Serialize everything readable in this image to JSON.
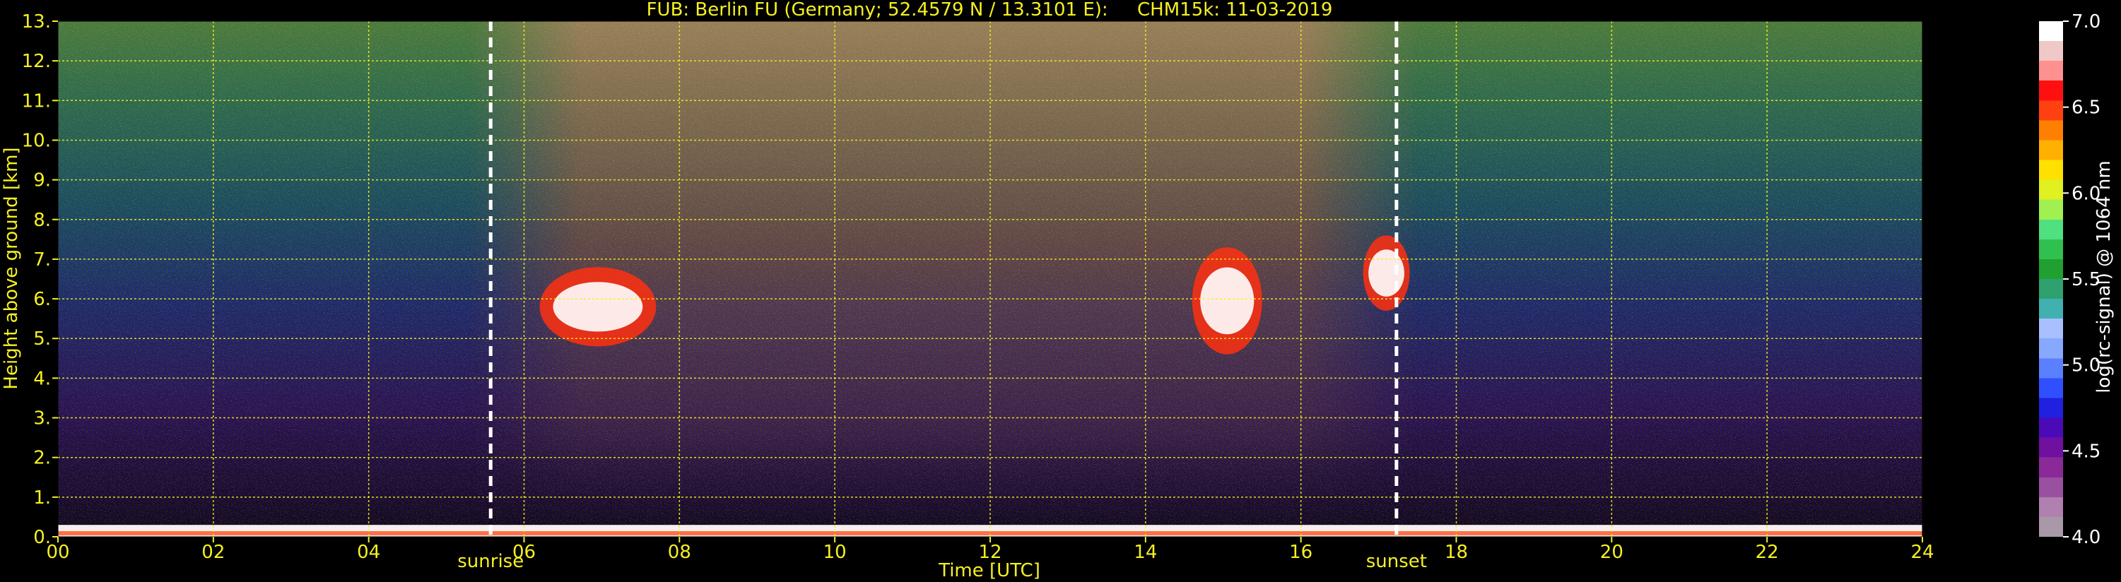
{
  "chart_data": {
    "type": "heatmap",
    "title": "FUB: Berlin FU (Germany; 52.4579 N / 13.3101 E):     CHM15k: 11-03-2019",
    "xlabel": "Time [UTC]",
    "ylabel": "Height above ground [km]",
    "colorbar_label": "log(rc-signal) @ 1064 nm",
    "xlim": [
      0,
      24
    ],
    "ylim": [
      0,
      13
    ],
    "clim": [
      4.0,
      7.0
    ],
    "grid": true,
    "x_ticks": [
      {
        "value": 0,
        "label": "00"
      },
      {
        "value": 2,
        "label": "02"
      },
      {
        "value": 4,
        "label": "04"
      },
      {
        "value": 6,
        "label": "06"
      },
      {
        "value": 8,
        "label": "08"
      },
      {
        "value": 10,
        "label": "10"
      },
      {
        "value": 12,
        "label": "12"
      },
      {
        "value": 14,
        "label": "14"
      },
      {
        "value": 16,
        "label": "16"
      },
      {
        "value": 18,
        "label": "18"
      },
      {
        "value": 20,
        "label": "20"
      },
      {
        "value": 22,
        "label": "22"
      },
      {
        "value": 24,
        "label": "24"
      }
    ],
    "y_ticks": [
      {
        "value": 0,
        "label": "0."
      },
      {
        "value": 1,
        "label": "1."
      },
      {
        "value": 2,
        "label": "2."
      },
      {
        "value": 3,
        "label": "3."
      },
      {
        "value": 4,
        "label": "4."
      },
      {
        "value": 5,
        "label": "5."
      },
      {
        "value": 6,
        "label": "6."
      },
      {
        "value": 7,
        "label": "7."
      },
      {
        "value": 8,
        "label": "8."
      },
      {
        "value": 9,
        "label": "9."
      },
      {
        "value": 10,
        "label": "10."
      },
      {
        "value": 11,
        "label": "11."
      },
      {
        "value": 12,
        "label": "12."
      },
      {
        "value": 13,
        "label": "13."
      }
    ],
    "colorbar_ticks": [
      {
        "value": 4.0,
        "label": "4.0"
      },
      {
        "value": 4.5,
        "label": "4.5"
      },
      {
        "value": 5.0,
        "label": "5.0"
      },
      {
        "value": 5.5,
        "label": "5.5"
      },
      {
        "value": 6.0,
        "label": "6.0"
      },
      {
        "value": 6.5,
        "label": "6.5"
      },
      {
        "value": 7.0,
        "label": "7.0"
      }
    ],
    "colormap": [
      "#a898a8",
      "#b080b0",
      "#9a50a0",
      "#8a2a98",
      "#7010a0",
      "#4a0ab8",
      "#2020e0",
      "#3050ff",
      "#5a80ff",
      "#88a8ff",
      "#a8c0ff",
      "#40b0b0",
      "#30a070",
      "#20a030",
      "#30c050",
      "#50e080",
      "#a0f050",
      "#e0f020",
      "#ffe000",
      "#ffb000",
      "#ff8000",
      "#ff4010",
      "#ff1010",
      "#ff9090",
      "#f0c8c8",
      "#ffffff"
    ],
    "events": [
      {
        "name": "sunrise",
        "time": 5.57
      },
      {
        "name": "sunset",
        "time": 17.23
      }
    ],
    "features": [
      {
        "kind": "boundary-layer",
        "from": 0,
        "to": 24,
        "top_km": 0.3
      },
      {
        "kind": "cloud",
        "from": 6.2,
        "to": 7.7,
        "base_km": 4.8,
        "top_km": 6.8
      },
      {
        "kind": "cloud",
        "from": 14.6,
        "to": 15.5,
        "base_km": 4.6,
        "top_km": 7.3
      },
      {
        "kind": "cloud",
        "from": 16.8,
        "to": 17.4,
        "base_km": 5.7,
        "top_km": 7.6
      }
    ]
  }
}
